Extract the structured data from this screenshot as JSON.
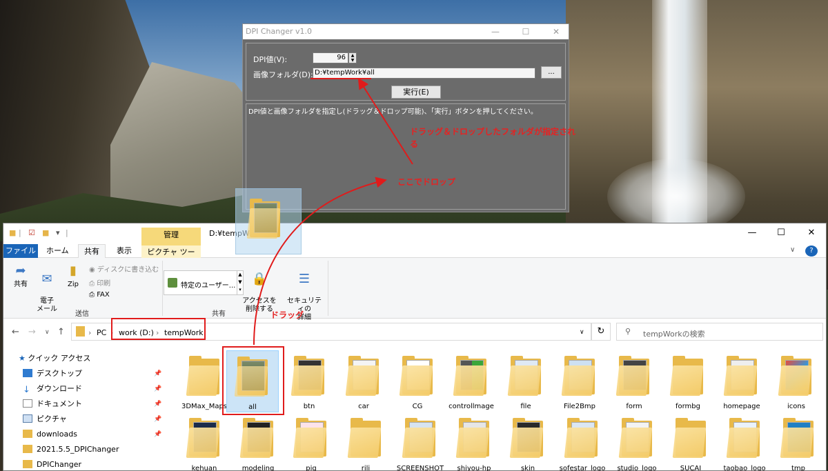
{
  "dpi_window": {
    "title": "DPI Changer v1.0",
    "dpi_label": "DPI値(V):",
    "dpi_value": "96",
    "folder_label": "画像フォルダ(D):",
    "folder_value": "D:¥tempWork¥all",
    "browse_label": "...",
    "run_label": "実行(E)",
    "log_text": "DPI値と画像フォルダを指定し(ドラッグ＆ドロップ可能)、「実行」ボタンを押してください。"
  },
  "annotations": {
    "folder_set_line1": "ドラッグ＆ドロップしたフォルダが指定され",
    "folder_set_line2": "る",
    "drop_here": "ここでドロップ",
    "drag": "ドラッグ"
  },
  "explorer": {
    "title_path": "D:¥tempWork",
    "manage_tab": "管理",
    "tabs": [
      "ファイル",
      "ホーム",
      "共有",
      "表示",
      "ピクチャ ツール"
    ],
    "ribbon": {
      "share": "共有",
      "email": "電子\nメール",
      "zip": "Zip",
      "burn_disc": "ディスクに書き込む",
      "print": "印刷",
      "fax": "FAX",
      "send_group": "送信",
      "specific_users": "特定のユーザー...",
      "remove_access": "アクセスを\n削除する",
      "security": "セキュリティの\n詳細",
      "share_group": "共有"
    },
    "breadcrumb": [
      "PC",
      "work (D:)",
      "tempWork"
    ],
    "search_placeholder": "tempWorkの検索",
    "nav": [
      {
        "label": "クイック アクセス",
        "pinned": false
      },
      {
        "label": "デスクトップ",
        "pinned": true
      },
      {
        "label": "ダウンロード",
        "pinned": true
      },
      {
        "label": "ドキュメント",
        "pinned": true
      },
      {
        "label": "ピクチャ",
        "pinned": true
      },
      {
        "label": "downloads",
        "pinned": true
      },
      {
        "label": "2021.5.5_DPIChanger",
        "pinned": false
      },
      {
        "label": "DPIChanger",
        "pinned": false
      }
    ],
    "files_row1": [
      "3DMax_Maps",
      "all",
      "btn",
      "car",
      "CG",
      "controllmage",
      "file",
      "File2Bmp",
      "form",
      "formbg",
      "homepage",
      "icons"
    ],
    "files_row2": [
      "kehuan",
      "modeling",
      "pig",
      "rili",
      "SCREENSHOT",
      "shiyou-hp",
      "skin",
      "sofestar_logo",
      "studio_logo",
      "SUCAI",
      "taobao_logo",
      "tmp"
    ]
  },
  "colors": {
    "annotation_red": "#e01b1b",
    "dpi_panel": "#6b6b6b",
    "file_tab_blue": "#1a65b8",
    "manage_tab_yellow": "#f6d97a",
    "folder_yellow": "#f4cc6a",
    "selection_blue": "#cce4f7"
  }
}
